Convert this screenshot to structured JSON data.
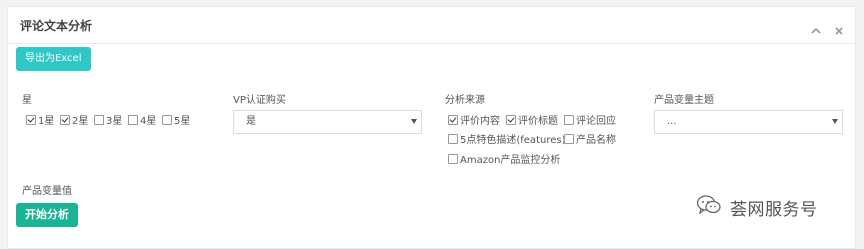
{
  "panel": {
    "title": "评论文本分析",
    "export_button": "导出为Excel",
    "start_button": "开始分析"
  },
  "star_filter": {
    "label": "星",
    "options": [
      {
        "label": "1星",
        "checked": true
      },
      {
        "label": "2星",
        "checked": true
      },
      {
        "label": "3星",
        "checked": false
      },
      {
        "label": "4星",
        "checked": false
      },
      {
        "label": "5星",
        "checked": false
      }
    ]
  },
  "vp_purchase": {
    "label": "VP认证购买",
    "selected": "是"
  },
  "analysis_source": {
    "label": "分析来源",
    "options": [
      {
        "label": "评价内容",
        "checked": true
      },
      {
        "label": "评价标题",
        "checked": true
      },
      {
        "label": "评论回应",
        "checked": false
      },
      {
        "label": "5点特色描述(features)",
        "checked": false
      },
      {
        "label": "产品名称",
        "checked": false
      },
      {
        "label": "Amazon产品监控分析",
        "checked": false
      }
    ]
  },
  "variant_theme": {
    "label": "产品变量主题",
    "selected": "..."
  },
  "variant_value": {
    "label": "产品变量值"
  },
  "watermark": {
    "text": "荟网服务号"
  }
}
